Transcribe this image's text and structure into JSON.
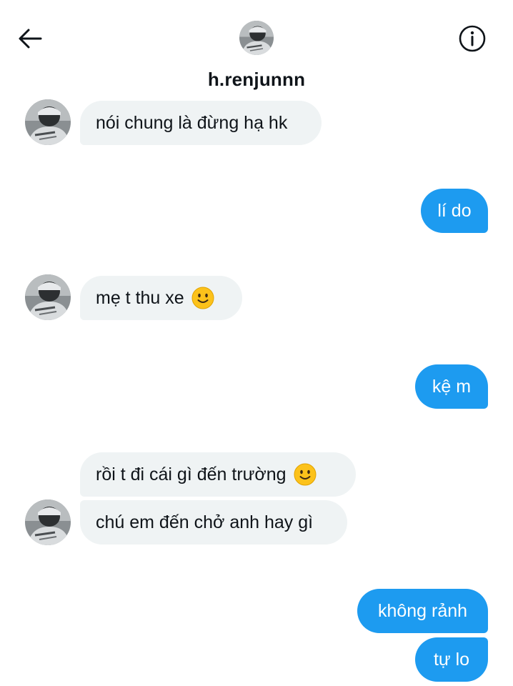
{
  "header": {
    "username": "h.renjunnn",
    "back_icon": "arrow-left-icon",
    "info_icon": "info-icon"
  },
  "colors": {
    "outgoing_bubble": "#1d9bf0",
    "incoming_bubble": "#eff3f4"
  },
  "messages": [
    {
      "direction": "in",
      "text": "nói chung là đừng hạ hk"
    },
    {
      "direction": "out",
      "text": "lí do"
    },
    {
      "direction": "in",
      "text": "mẹ t thu xe",
      "emoji": "slightly-smiling-face"
    },
    {
      "direction": "out",
      "text": "kệ m"
    },
    {
      "direction": "in",
      "text": "rồi t đi cái gì đến trường",
      "emoji": "slightly-smiling-face"
    },
    {
      "direction": "in",
      "text": "chú em đến chở anh hay gì"
    },
    {
      "direction": "out",
      "text": "không rảnh"
    },
    {
      "direction": "out",
      "text": "tự lo"
    }
  ]
}
